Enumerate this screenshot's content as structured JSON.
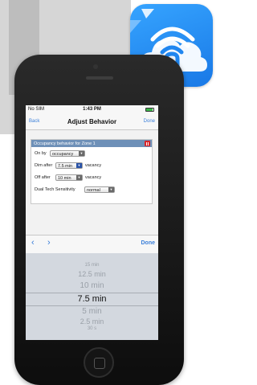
{
  "status_bar": {
    "carrier": "No SIM",
    "time": "1:43 PM"
  },
  "nav": {
    "back": "Back",
    "title": "Adjust Behavior",
    "done": "Done"
  },
  "card": {
    "header": "Occupancy behavior for Zone 1",
    "on_by_label": "On by",
    "on_by_value": "occupancy",
    "dim_after_label": "Dim after",
    "dim_after_value": "7.5 min",
    "dim_after_suffix": "vacancy",
    "off_after_label": "Off after",
    "off_after_value": "10 min",
    "off_after_suffix": "vacancy",
    "sensitivity_label": "Dual Tech Sensitivity",
    "sensitivity_value": "normal"
  },
  "toolbar": {
    "prev": "‹",
    "next": "›",
    "done": "Done"
  },
  "picker": {
    "items": [
      "15 min",
      "12.5 min",
      "10 min",
      "7.5 min",
      "5 min",
      "2.5 min",
      "30 s"
    ],
    "selected": "7.5 min"
  },
  "colors": {
    "accent": "#3b7fd9",
    "card_header": "#6e90b8",
    "delete": "#d7252b",
    "icon_bg": "#1f86f0"
  },
  "icons": [
    "wifi-n-cloud-icon",
    "trash-icon",
    "chevron-left-icon",
    "chevron-right-icon",
    "wifi-icon",
    "battery-icon",
    "dropdown-arrow-icon"
  ]
}
